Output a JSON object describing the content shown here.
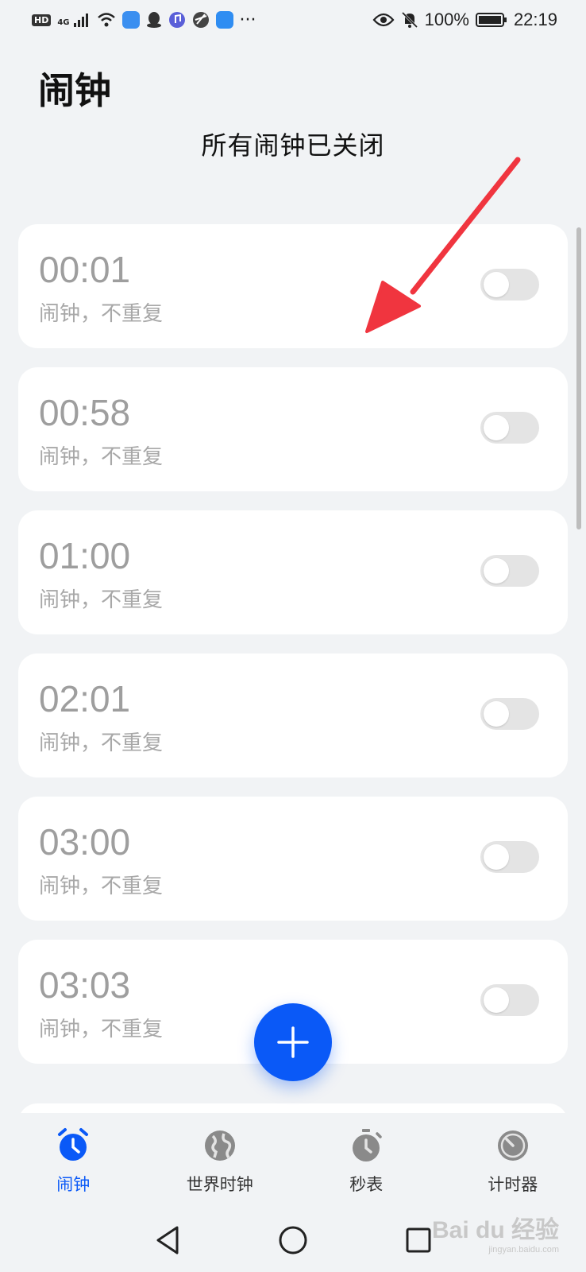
{
  "status_bar": {
    "hd": "HD",
    "network": "4G",
    "battery": "100%",
    "time": "22:19",
    "more": "···"
  },
  "header": {
    "title": "闹钟",
    "status_text": "所有闹钟已关闭"
  },
  "alarms": [
    {
      "time": "00:01",
      "desc": "闹钟，不重复",
      "enabled": false
    },
    {
      "time": "00:58",
      "desc": "闹钟，不重复",
      "enabled": false
    },
    {
      "time": "01:00",
      "desc": "闹钟，不重复",
      "enabled": false
    },
    {
      "time": "02:01",
      "desc": "闹钟，不重复",
      "enabled": false
    },
    {
      "time": "03:00",
      "desc": "闹钟，不重复",
      "enabled": false
    },
    {
      "time": "03:03",
      "desc": "闹钟，不重复",
      "enabled": false
    }
  ],
  "tabs": [
    {
      "label": "闹钟",
      "icon": "alarm-clock-icon",
      "active": true
    },
    {
      "label": "世界时钟",
      "icon": "globe-icon",
      "active": false
    },
    {
      "label": "秒表",
      "icon": "stopwatch-icon",
      "active": false
    },
    {
      "label": "计时器",
      "icon": "timer-icon",
      "active": false
    }
  ],
  "colors": {
    "accent": "#0a59f7",
    "annotation_arrow": "#f0353f",
    "background": "#f1f3f5"
  },
  "watermark": {
    "brand": "Bai du 经验",
    "url": "jingyan.baidu.com"
  }
}
